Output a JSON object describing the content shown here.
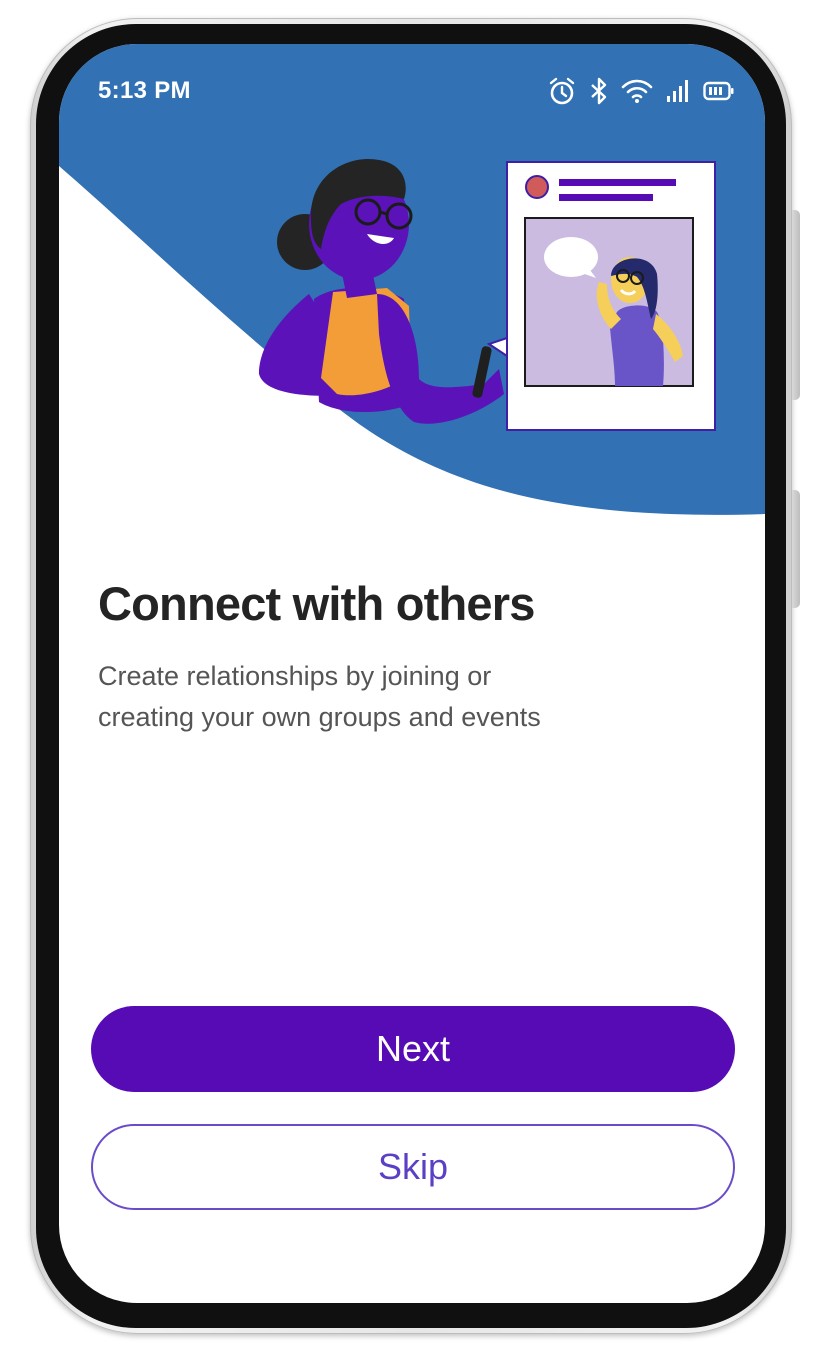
{
  "status_bar": {
    "time": "5:13 PM",
    "icons": [
      "alarm-icon",
      "bluetooth-icon",
      "wifi-icon",
      "signal-icon",
      "battery-icon"
    ]
  },
  "onboarding": {
    "title": "Connect with others",
    "description": "Create relationships by joining or creating your own groups and events"
  },
  "actions": {
    "next_label": "Next",
    "skip_label": "Skip"
  },
  "colors": {
    "hero_background": "#3171b4",
    "primary": "#560bb5",
    "skip_border": "#6a4cc9",
    "title_text": "#242424",
    "body_text": "#555555"
  }
}
